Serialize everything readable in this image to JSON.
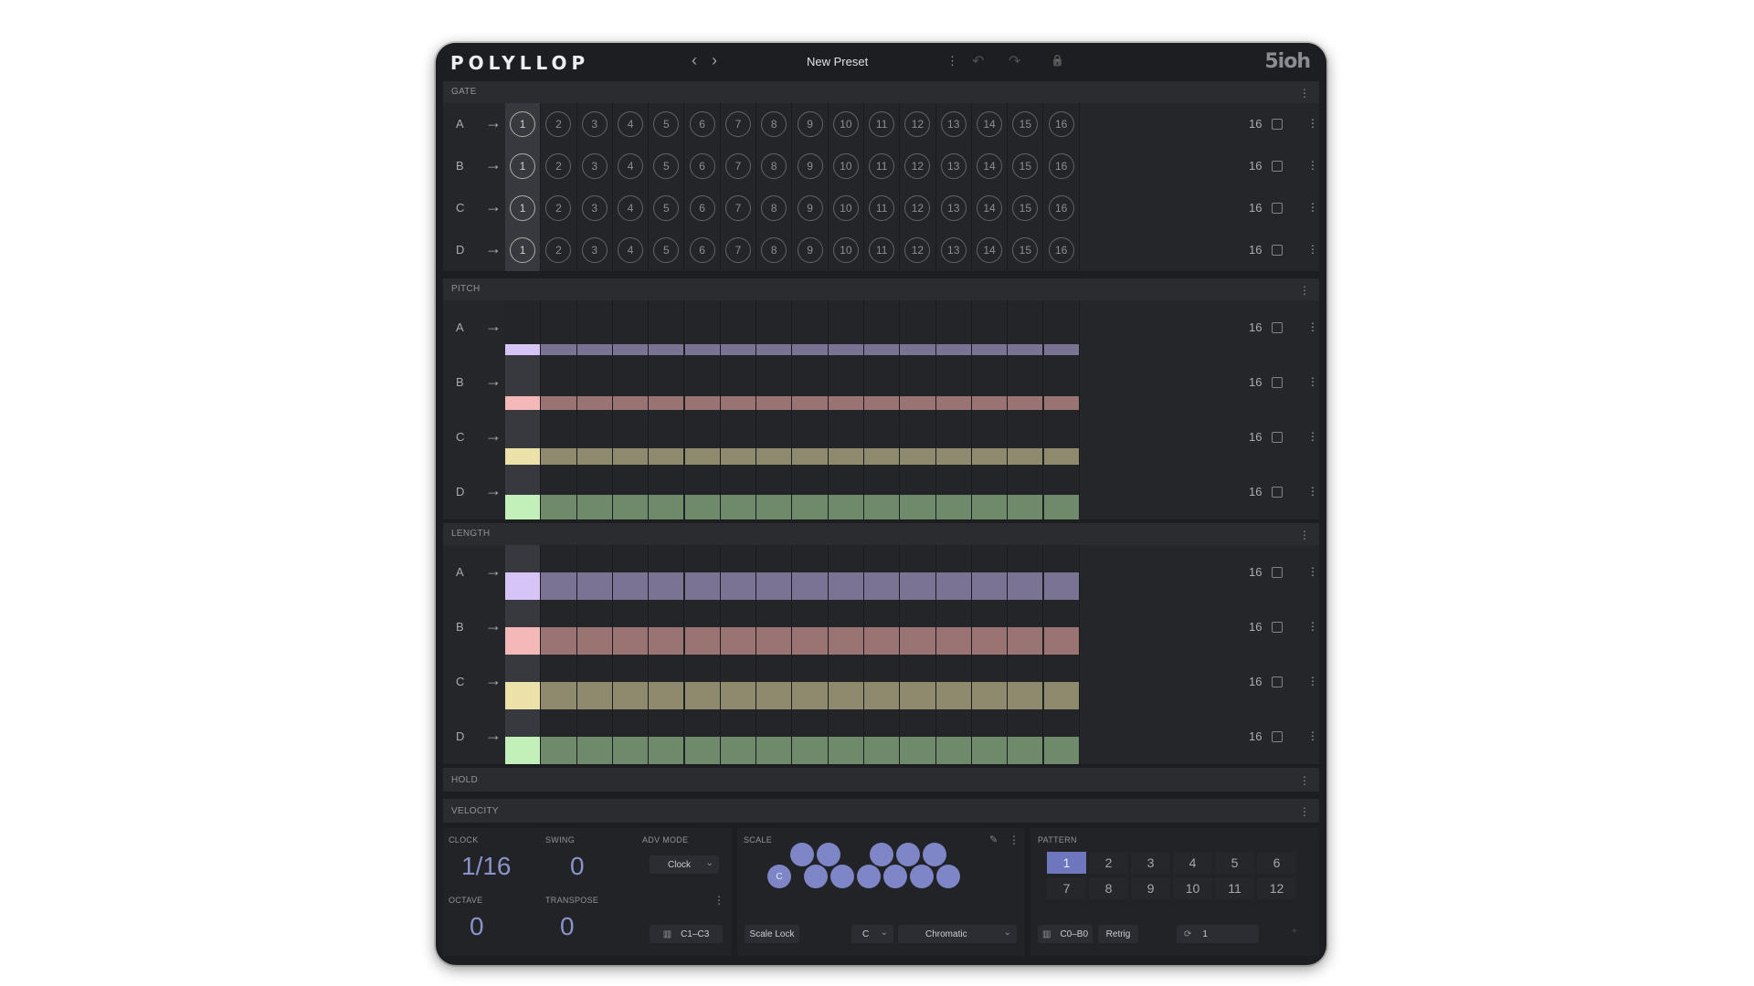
{
  "app": {
    "logo": "POLYLLOP",
    "preset_name": "New Preset",
    "brand": "5ioh"
  },
  "toolbar": {
    "prev": "‹",
    "next": "›",
    "menu": "⋮",
    "undo": "↶",
    "redo": "↷",
    "lock": "🔒"
  },
  "lanes": [
    "A",
    "B",
    "C",
    "D"
  ],
  "steps": [
    "1",
    "2",
    "3",
    "4",
    "5",
    "6",
    "7",
    "8",
    "9",
    "10",
    "11",
    "12",
    "13",
    "14",
    "15",
    "16"
  ],
  "lane_length": "16",
  "colors": {
    "A": "#d6c4f7",
    "A_dim": "#7b7394",
    "B": "#f5b8b8",
    "B_dim": "#9a7373",
    "C": "#ece1a8",
    "C_dim": "#8e8a6e",
    "D": "#c3f0b8",
    "D_dim": "#6e8a6b"
  },
  "sections": {
    "gate": "GATE",
    "pitch": "PITCH",
    "length": "LENGTH",
    "hold": "HOLD",
    "velocity": "VELOCITY"
  },
  "bottom": {
    "clock_label": "CLOCK",
    "clock_value": "1/16",
    "swing_label": "SWING",
    "swing_value": "0",
    "adv_label": "ADV MODE",
    "adv_value": "Clock",
    "octave_label": "OCTAVE",
    "octave_value": "0",
    "transpose_label": "TRANSPOSE",
    "transpose_value": "0",
    "range_value": "C1–C3",
    "scale_label": "SCALE",
    "scale_root_note": "C",
    "scale_lock": "Scale Lock",
    "scale_key": "C",
    "scale_type": "Chromatic",
    "pattern_label": "PATTERN",
    "patterns": [
      "1",
      "2",
      "3",
      "4",
      "5",
      "6",
      "7",
      "8",
      "9",
      "10",
      "11",
      "12"
    ],
    "pattern_range": "C0–B0",
    "retrig": "Retrig",
    "loop_count": "1"
  }
}
